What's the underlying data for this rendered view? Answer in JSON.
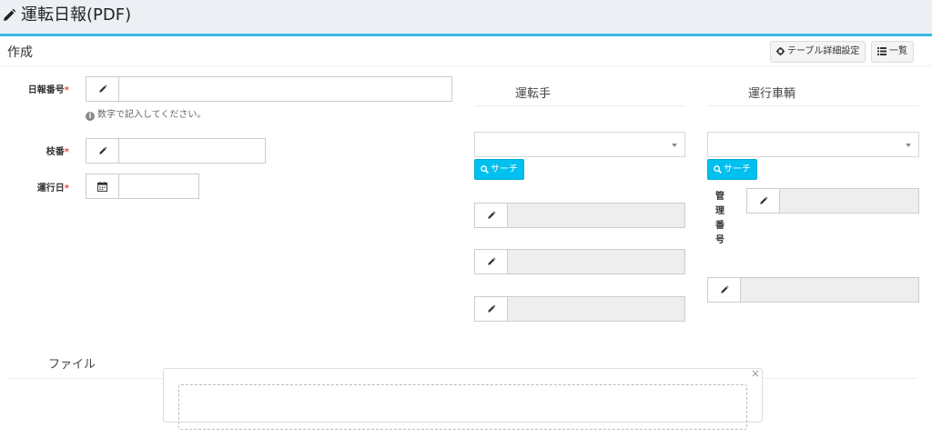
{
  "header": {
    "title": "運転日報(PDF)",
    "icon": "pencil-icon"
  },
  "box": {
    "title": "作成",
    "table_settings_label": "テーブル詳細設定",
    "list_label": "一覧"
  },
  "form": {
    "report_number": {
      "label": "日報番号",
      "required_mark": "*",
      "value": "",
      "help": "数字で記入してください。"
    },
    "branch_number": {
      "label": "枝番",
      "required_mark": "*",
      "value": ""
    },
    "operation_date": {
      "label": "運行日",
      "required_mark": "*",
      "value": ""
    }
  },
  "driver": {
    "title": "運転手",
    "search_label": "サーチ",
    "selected": "",
    "fields": [
      "",
      "",
      ""
    ]
  },
  "vehicle": {
    "title": "運行車輌",
    "search_label": "サーチ",
    "selected": "",
    "management_number_label": [
      "管",
      "理",
      "番",
      "号"
    ],
    "fields": [
      "",
      ""
    ]
  },
  "file": {
    "title": "ファイル",
    "close_label": "×"
  },
  "colors": {
    "accent": "#3bbbe4",
    "search_button": "#00c0ef",
    "required": "#dd4b39"
  }
}
